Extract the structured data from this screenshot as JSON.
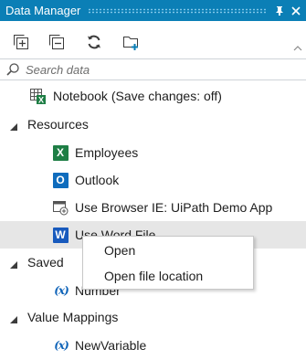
{
  "panel": {
    "title": "Data Manager",
    "accent_color": "#0b7fb6"
  },
  "toolbar": {
    "buttons": [
      {
        "icon": "expand-all-icon"
      },
      {
        "icon": "collapse-all-icon"
      },
      {
        "icon": "refresh-icon"
      },
      {
        "icon": "new-folder-icon"
      }
    ]
  },
  "search": {
    "placeholder": "Search data"
  },
  "tree": {
    "notebook": {
      "label": "Notebook (Save changes: off)",
      "icon": "excel-notebook-icon"
    },
    "resources": {
      "label": "Resources",
      "items": [
        {
          "label": "Employees",
          "icon": "excel-icon",
          "badge": "X",
          "color": "#1e7e45"
        },
        {
          "label": "Outlook",
          "icon": "outlook-icon",
          "badge": "O",
          "color": "#0f6cbd"
        },
        {
          "label": "Use Browser IE: UiPath Demo App",
          "icon": "browser-icon"
        },
        {
          "label": "Use Word File",
          "icon": "word-icon",
          "badge": "W",
          "color": "#185abd"
        }
      ]
    },
    "saved": {
      "label": "Saved",
      "items": [
        {
          "label": "Number",
          "icon": "variable-icon"
        }
      ]
    },
    "value_mappings": {
      "label": "Value Mappings",
      "items": [
        {
          "label": "NewVariable",
          "icon": "variable-icon"
        }
      ]
    }
  },
  "context_menu": {
    "items": [
      {
        "label": "Open"
      },
      {
        "label": "Open file location"
      }
    ]
  },
  "var_glyph": "(x)"
}
